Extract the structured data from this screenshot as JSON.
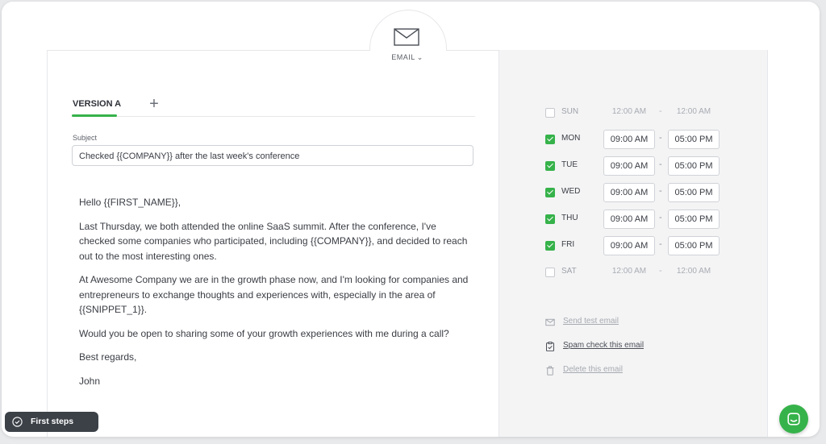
{
  "header": {
    "step_type": "EMAIL",
    "step_icon": "envelope-icon",
    "dropdown_icon": "chevron-down-icon"
  },
  "editor": {
    "tabs": [
      {
        "label": "VERSION A",
        "active": true
      }
    ],
    "add_tab_icon": "plus-icon",
    "subject_label": "Subject",
    "subject_value": "Checked {{COMPANY}} after the last week's conference",
    "body_paragraphs": [
      "Hello {{FIRST_NAME}},",
      "Last Thursday, we both attended the online SaaS summit. After the conference, I've checked some companies who participated, including {{COMPANY}}, and decided to reach out to the most interesting ones.",
      "At Awesome Company we are in the growth phase now, and I'm looking for companies and entrepreneurs to exchange thoughts and experiences with, especially in the area of {{SNIPPET_1}}.",
      "Would you be open to sharing some of your growth experiences with me during a call?",
      "Best regards,",
      "John"
    ]
  },
  "schedule": {
    "days": [
      {
        "day": "SUN",
        "enabled": false,
        "from": "12:00 AM",
        "to": "12:00 AM"
      },
      {
        "day": "MON",
        "enabled": true,
        "from": "09:00 AM",
        "to": "05:00 PM"
      },
      {
        "day": "TUE",
        "enabled": true,
        "from": "09:00 AM",
        "to": "05:00 PM"
      },
      {
        "day": "WED",
        "enabled": true,
        "from": "09:00 AM",
        "to": "05:00 PM"
      },
      {
        "day": "THU",
        "enabled": true,
        "from": "09:00 AM",
        "to": "05:00 PM"
      },
      {
        "day": "FRI",
        "enabled": true,
        "from": "09:00 AM",
        "to": "05:00 PM"
      },
      {
        "day": "SAT",
        "enabled": false,
        "from": "12:00 AM",
        "to": "12:00 AM"
      }
    ],
    "separator": "-"
  },
  "actions": [
    {
      "label": "Send test email",
      "icon": "envelope-icon"
    },
    {
      "label": "Spam check this email",
      "icon": "clipboard-icon"
    },
    {
      "label": "Delete this email",
      "icon": "trash-icon"
    }
  ],
  "first_steps": {
    "label": "First steps",
    "icon": "check-circle-icon"
  },
  "chat": {
    "icon": "chat-icon"
  },
  "colors": {
    "accent": "#36b24a",
    "dark_pill": "#3c4148",
    "side_panel": "#f4f4f5"
  }
}
